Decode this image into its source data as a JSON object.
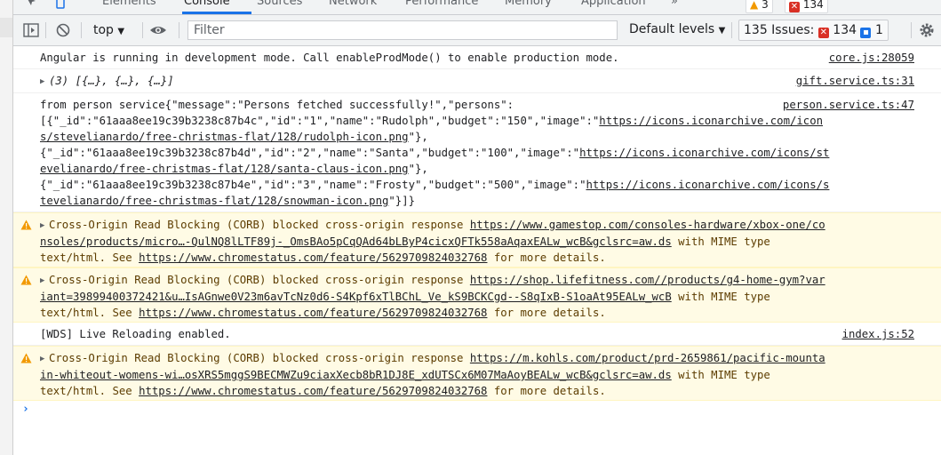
{
  "tabs": [
    "Elements",
    "Console",
    "Sources",
    "Network",
    "Performance",
    "Memory",
    "Application"
  ],
  "tabs_more": "»",
  "top_badges": {
    "warnings": "3",
    "errors": "134"
  },
  "toolbar": {
    "context": "top",
    "filter_placeholder": "Filter",
    "levels": "Default levels",
    "issues_label": "135 Issues:",
    "issues_errors": "134",
    "issues_info": "1"
  },
  "messages": [
    {
      "type": "log",
      "source": "core.js:28059",
      "lines": [
        "Angular is running in development mode. Call enableProdMode() to enable production mode."
      ]
    },
    {
      "type": "log",
      "source": "gift.service.ts:31",
      "lines": [
        "(3) [{…}, {…}, {…}]"
      ]
    },
    {
      "type": "log",
      "source": "person.service.ts:47",
      "lines": [
        "from person service{\"message\":\"Persons fetched successfully!\",\"persons\":",
        "[{\"_id\":\"61aaa8ee19c39b3238c87b4c\",\"id\":\"1\",\"name\":\"Rudolph\",\"budget\":\"150\",\"image\":\"https://icons.iconarchive.com/icon",
        "s/stevelianardo/free-christmas-flat/128/rudolph-icon.png\"},",
        "{\"_id\":\"61aaa8ee19c39b3238c87b4d\",\"id\":\"2\",\"name\":\"Santa\",\"budget\":\"100\",\"image\":\"https://icons.iconarchive.com/icons/st",
        "evelianardo/free-christmas-flat/128/santa-claus-icon.png\"},",
        "{\"_id\":\"61aaa8ee19c39b3238c87b4e\",\"id\":\"3\",\"name\":\"Frosty\",\"budget\":\"500\",\"image\":\"https://icons.iconarchive.com/icons/s",
        "tevelianardo/free-christmas-flat/128/snowman-icon.png\"}]}"
      ]
    },
    {
      "type": "warning",
      "source": "",
      "lines": [
        "Cross-Origin Read Blocking (CORB) blocked cross-origin response https://www.gamestop.com/consoles-hardware/xbox-one/co",
        "nsoles/products/micro…-QulNQ8lLTF89j-_OmsBAo5pCqQAd64bLByP4cicxQFTk558aAqaxEALw_wcB&gclsrc=aw.ds with MIME type",
        "text/html. See https://www.chromestatus.com/feature/5629709824032768 for more details."
      ]
    },
    {
      "type": "warning",
      "source": "",
      "lines": [
        "Cross-Origin Read Blocking (CORB) blocked cross-origin response https://shop.lifefitness.com//products/g4-home-gym?var",
        "iant=39899400372421&u…IsAGnwe0V23m6avTcNz0d6-S4Kpf6xTlBChL_Ve_kS9BCKCgd--S8qIxB-S1oaAt95EALw_wcB with MIME type",
        "text/html. See https://www.chromestatus.com/feature/5629709824032768 for more details."
      ]
    },
    {
      "type": "log",
      "source": "index.js:52",
      "lines": [
        "[WDS] Live Reloading enabled."
      ]
    },
    {
      "type": "warning",
      "source": "",
      "lines": [
        "Cross-Origin Read Blocking (CORB) blocked cross-origin response https://m.kohls.com/product/prd-2659861/pacific-mounta",
        "in-whiteout-womens-wi…osXRS5mggS9BECMWZu9ciaxXecb8bR1DJ8E_xdUTSCx6M07MaAoyBEALw_wcB&gclsrc=aw.ds with MIME type",
        "text/html. See https://www.chromestatus.com/feature/5629709824032768 for more details."
      ]
    }
  ],
  "prompt": "›",
  "colors": {
    "accent": "#1a73e8",
    "warning_bg": "#fffbe5",
    "error": "#d93025"
  }
}
